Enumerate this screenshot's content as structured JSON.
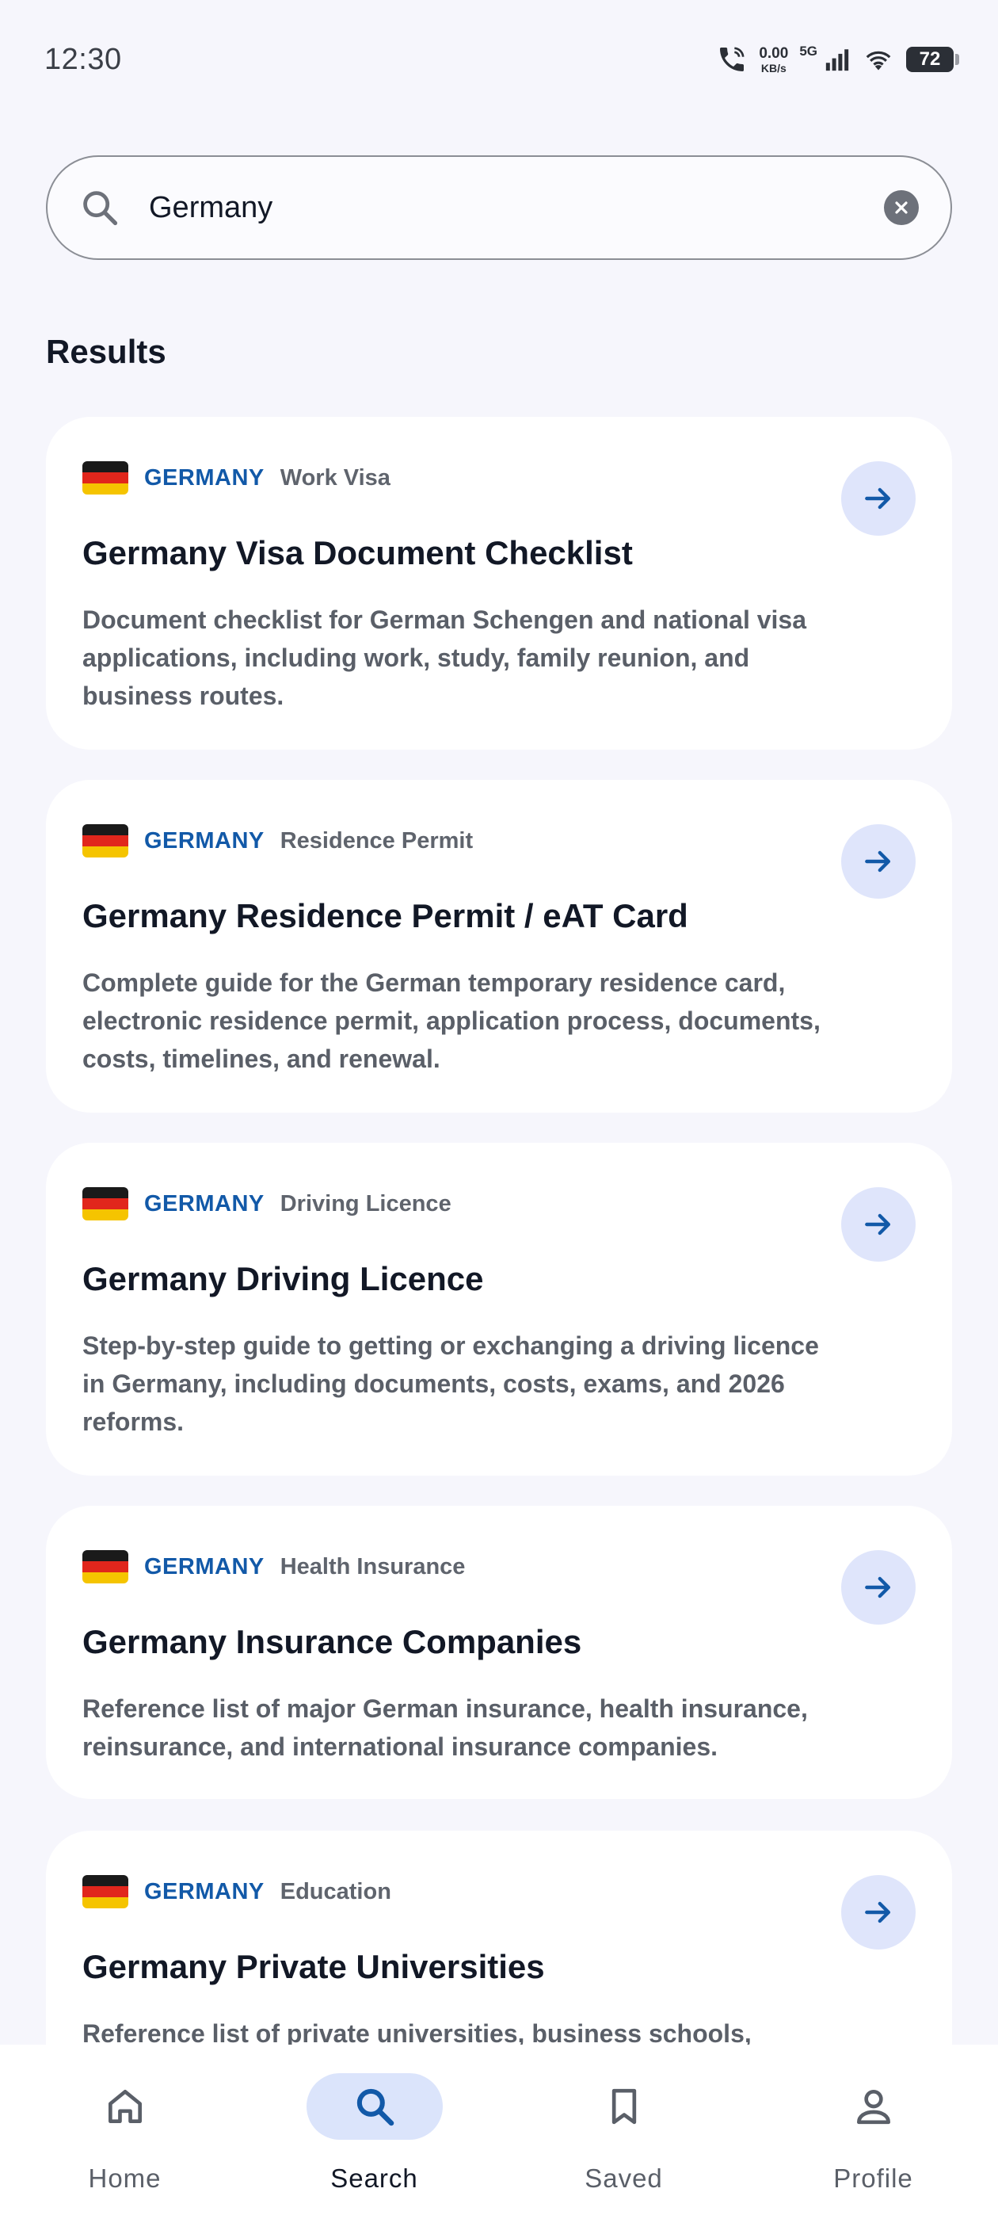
{
  "status_bar": {
    "time": "12:30",
    "net_speed_value": "0.00",
    "net_speed_unit": "KB/s",
    "network_type": "5G",
    "battery_level": "72"
  },
  "search": {
    "value": "Germany",
    "placeholder": ""
  },
  "results": {
    "heading": "Results",
    "items": [
      {
        "country": "GERMANY",
        "category": "Work Visa",
        "title": "Germany Visa Document Checklist",
        "description": "Document checklist for German Schengen and national visa applications, including work, study, family reunion, and business routes."
      },
      {
        "country": "GERMANY",
        "category": "Residence Permit",
        "title": "Germany Residence Permit / eAT Card",
        "description": "Complete guide for the German temporary residence card, electronic residence permit, application process, documents, costs, timelines, and renewal."
      },
      {
        "country": "GERMANY",
        "category": "Driving Licence",
        "title": "Germany Driving Licence",
        "description": "Step-by-step guide to getting or exchanging a driving licence in Germany, including documents, costs, exams, and 2026 reforms."
      },
      {
        "country": "GERMANY",
        "category": "Health Insurance",
        "title": "Germany Insurance Companies",
        "description": "Reference list of major German insurance, health insurance, reinsurance, and international insurance companies."
      },
      {
        "country": "GERMANY",
        "category": "Education",
        "title": "Germany Private Universities",
        "description": "Reference list of private universities, business schools,"
      }
    ]
  },
  "bottom_nav": {
    "items": [
      {
        "label": "Home",
        "icon": "home-icon"
      },
      {
        "label": "Search",
        "icon": "search-icon",
        "active": true
      },
      {
        "label": "Saved",
        "icon": "bookmark-icon"
      },
      {
        "label": "Profile",
        "icon": "person-icon"
      }
    ]
  },
  "colors": {
    "background": "#f6f6fc",
    "accent": "#1259a8",
    "accent_soft": "#dfe5fb"
  }
}
